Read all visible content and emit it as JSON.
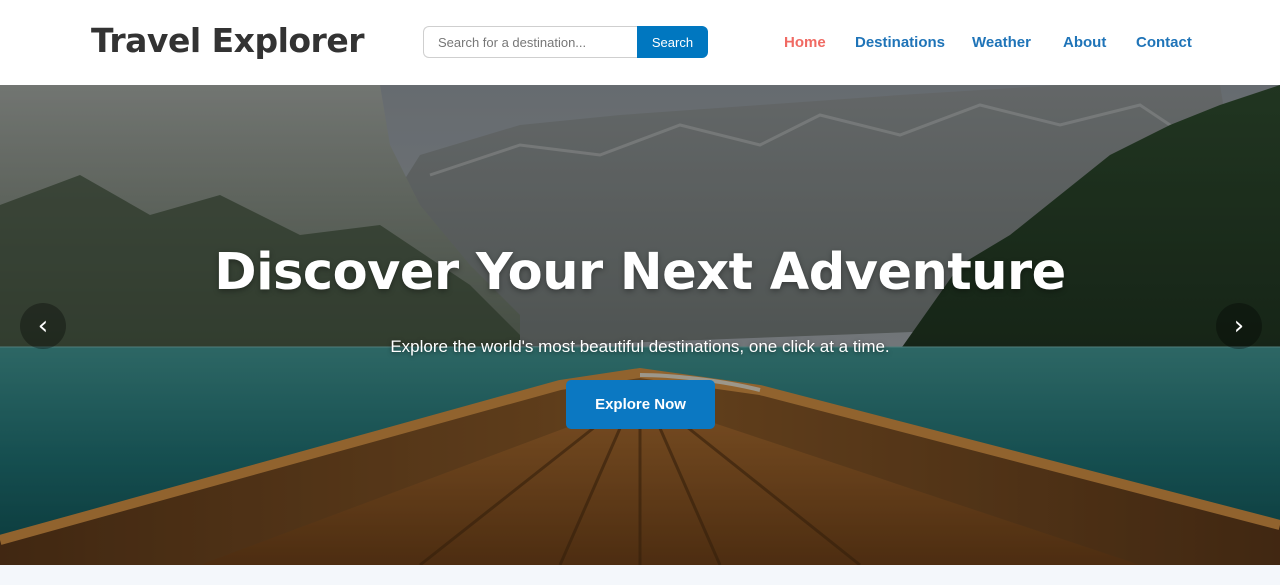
{
  "header": {
    "logo": "Travel Explorer",
    "search": {
      "placeholder": "Search for a destination...",
      "value": "",
      "button_label": "Search"
    },
    "nav": [
      {
        "label": "Home",
        "active": true
      },
      {
        "label": "Destinations",
        "active": false
      },
      {
        "label": "Weather",
        "active": false
      },
      {
        "label": "About",
        "active": false
      },
      {
        "label": "Contact",
        "active": false
      }
    ]
  },
  "hero": {
    "title": "Discover Your Next Adventure",
    "subtitle": "Explore the world's most beautiful destinations, one click at a time.",
    "cta_label": "Explore Now",
    "prev_icon": "‹",
    "next_icon": "›"
  },
  "colors": {
    "accent": "#0077c0",
    "nav_link": "#1f74b8",
    "nav_active": "#f06a63",
    "logo_text": "#333333"
  }
}
